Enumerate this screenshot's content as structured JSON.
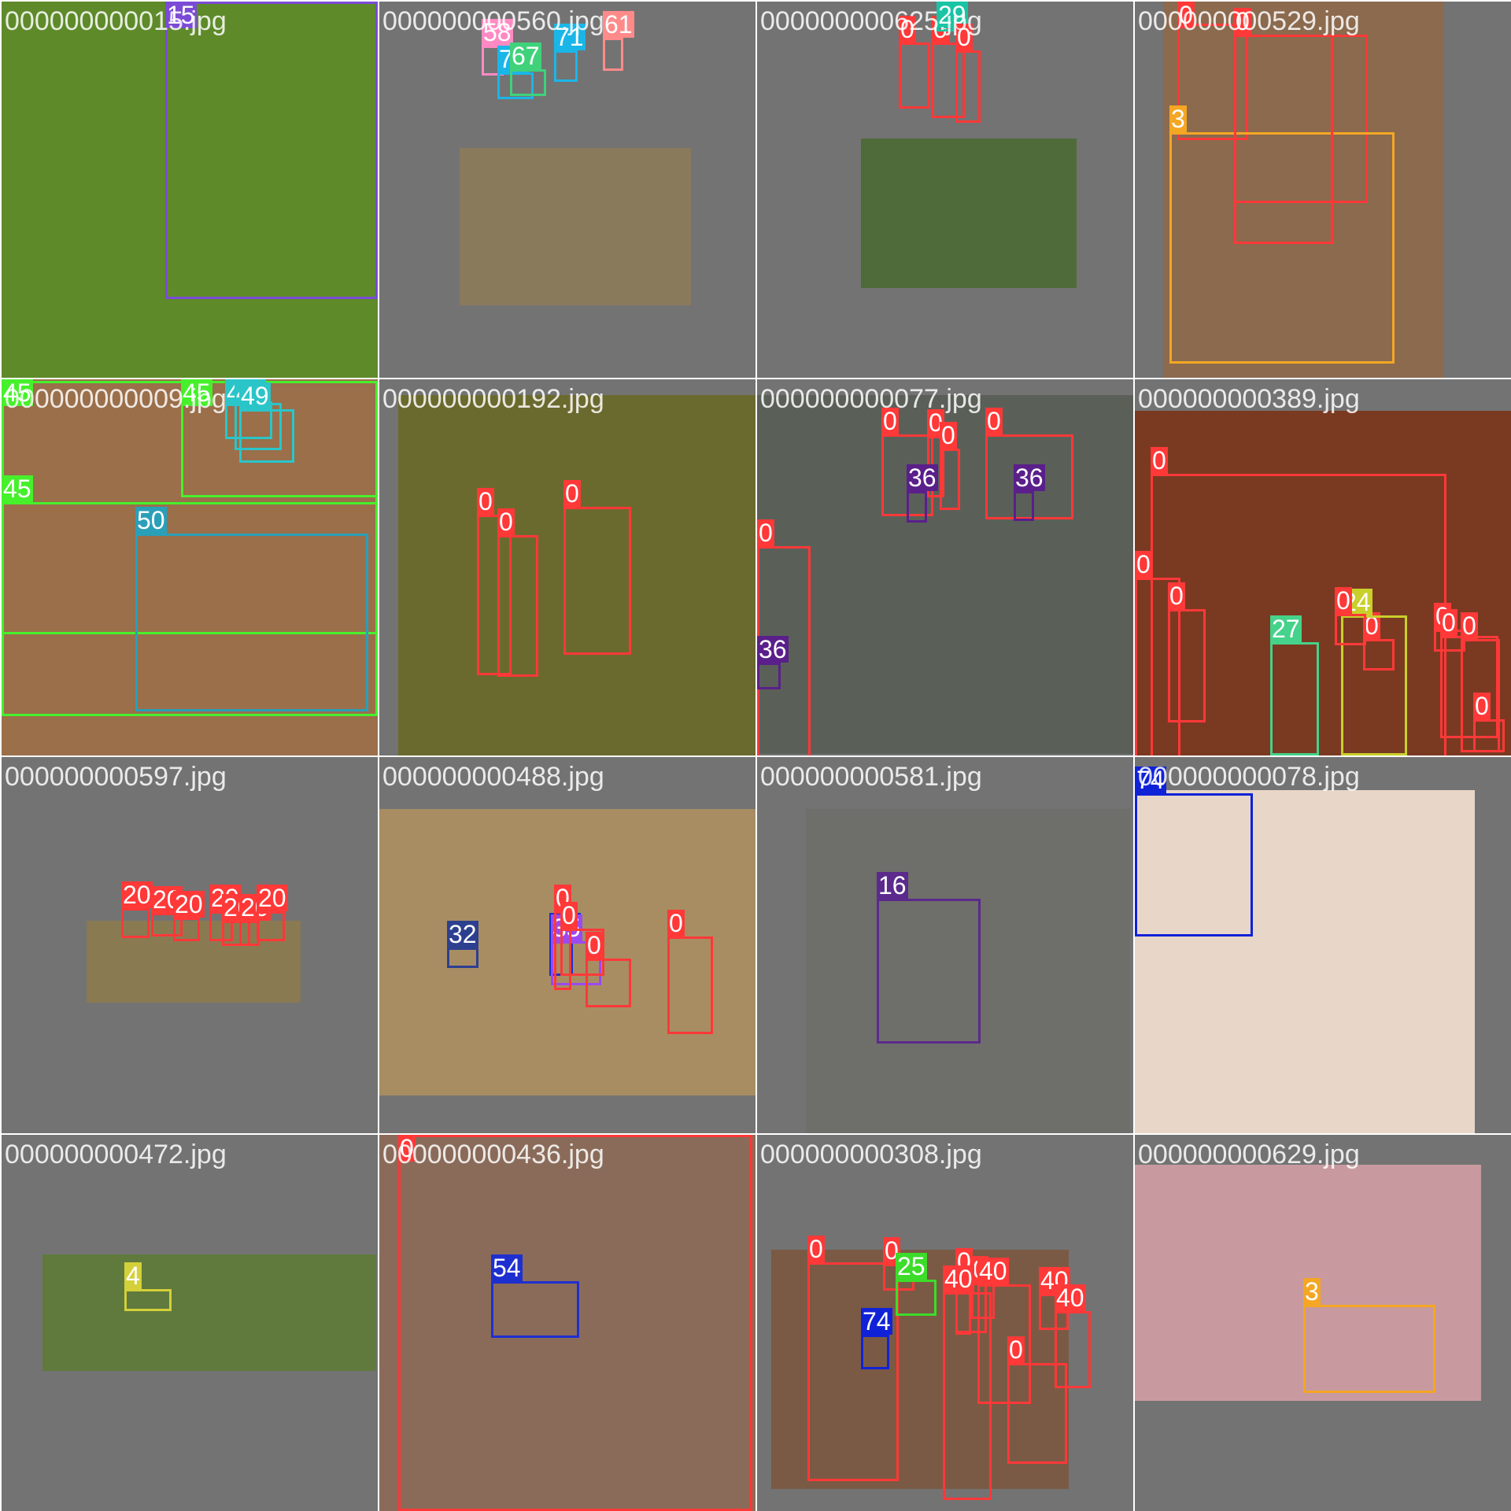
{
  "title": "",
  "colors": {
    "background": "#737373",
    "class_0": "#ff3838",
    "class_3": "#f5a623",
    "class_4": "#d4d03a",
    "class_15": "#7b4bd6",
    "class_16": "#5b2a8c",
    "class_20": "#ff3838",
    "class_24": "#c9cf2b",
    "class_25": "#3ddc2b",
    "class_27": "#45d28a",
    "class_29": "#19c4a4",
    "class_32": "#2d3f8f",
    "class_34": "#1430d2",
    "class_35": "#9b49f2",
    "class_36": "#5a1f8a",
    "class_40": "#ff3838",
    "class_45": "#46f02b",
    "class_49": "#2ac5c9",
    "class_50": "#2a9fb8",
    "class_54": "#1e2fd0",
    "class_58": "#ff8ac3",
    "class_61": "#ff8a8a",
    "class_67": "#3fd27a",
    "class_71": "#1bb6e8",
    "class_74": "#1022d8"
  },
  "tiles": [
    {
      "filename": "000000000015.jpg",
      "photo_color": "#5e8a2a",
      "boxes": [
        {
          "label": "15",
          "color": "#7b4bd6"
        }
      ]
    },
    {
      "filename": "000000000560.jpg",
      "photo_color": "#8a7a5c",
      "boxes": [
        {
          "label": "58",
          "color": "#ff8ac3"
        },
        {
          "label": "71",
          "color": "#1bb6e8"
        },
        {
          "label": "67",
          "color": "#3fd27a"
        },
        {
          "label": "71",
          "color": "#1bb6e8"
        },
        {
          "label": "61",
          "color": "#ff8a8a"
        }
      ]
    },
    {
      "filename": "000000000625.jpg",
      "photo_color": "#4f6b3a",
      "boxes": [
        {
          "label": "0",
          "color": "#ff3838"
        },
        {
          "label": "0",
          "color": "#ff3838"
        },
        {
          "label": "29",
          "color": "#19c4a4"
        },
        {
          "label": "0",
          "color": "#ff3838"
        }
      ]
    },
    {
      "filename": "000000000529.jpg",
      "photo_color": "#8b6a4e",
      "boxes": [
        {
          "label": "0",
          "color": "#ff3838"
        },
        {
          "label": "0",
          "color": "#ff3838"
        },
        {
          "label": "3",
          "color": "#f5a623"
        },
        {
          "label": "0",
          "color": "#ff3838"
        }
      ]
    },
    {
      "filename": "000000000009.jpg",
      "photo_color": "#9a6f4a",
      "boxes": [
        {
          "label": "45",
          "color": "#46f02b"
        },
        {
          "label": "45",
          "color": "#46f02b"
        },
        {
          "label": "49",
          "color": "#2ac5c9"
        },
        {
          "label": "49",
          "color": "#2ac5c9"
        },
        {
          "label": "49",
          "color": "#2ac5c9"
        },
        {
          "label": "45",
          "color": "#46f02b"
        },
        {
          "label": "50",
          "color": "#2a9fb8"
        }
      ]
    },
    {
      "filename": "000000000192.jpg",
      "photo_color": "#6b6a2e",
      "boxes": [
        {
          "label": "0",
          "color": "#ff3838"
        },
        {
          "label": "0",
          "color": "#ff3838"
        },
        {
          "label": "0",
          "color": "#ff3838"
        }
      ]
    },
    {
      "filename": "000000000077.jpg",
      "photo_color": "#5a6058",
      "boxes": [
        {
          "label": "0",
          "color": "#ff3838"
        },
        {
          "label": "0",
          "color": "#ff3838"
        },
        {
          "label": "0",
          "color": "#ff3838"
        },
        {
          "label": "0",
          "color": "#ff3838"
        },
        {
          "label": "36",
          "color": "#5a1f8a"
        },
        {
          "label": "36",
          "color": "#5a1f8a"
        },
        {
          "label": "0",
          "color": "#ff3838"
        },
        {
          "label": "36",
          "color": "#5a1f8a"
        }
      ]
    },
    {
      "filename": "000000000389.jpg",
      "photo_color": "#7a3a22",
      "boxes": [
        {
          "label": "0",
          "color": "#ff3838"
        },
        {
          "label": "0",
          "color": "#ff3838"
        },
        {
          "label": "0",
          "color": "#ff3838"
        },
        {
          "label": "0",
          "color": "#ff3838"
        },
        {
          "label": "27",
          "color": "#45d28a"
        },
        {
          "label": "24",
          "color": "#c9cf2b"
        },
        {
          "label": "0",
          "color": "#ff3838"
        },
        {
          "label": "0",
          "color": "#ff3838"
        },
        {
          "label": "0",
          "color": "#ff3838"
        },
        {
          "label": "0",
          "color": "#ff3838"
        },
        {
          "label": "0",
          "color": "#ff3838"
        }
      ]
    },
    {
      "filename": "000000000597.jpg",
      "photo_color": "#8a7a52",
      "boxes": [
        {
          "label": "20",
          "color": "#ff3838"
        },
        {
          "label": "20",
          "color": "#ff3838"
        },
        {
          "label": "20",
          "color": "#ff3838"
        },
        {
          "label": "20",
          "color": "#ff3838"
        },
        {
          "label": "20",
          "color": "#ff3838"
        },
        {
          "label": "20",
          "color": "#ff3838"
        },
        {
          "label": "20",
          "color": "#ff3838"
        }
      ]
    },
    {
      "filename": "000000000488.jpg",
      "photo_color": "#a88d63",
      "boxes": [
        {
          "label": "32",
          "color": "#2d3f8f"
        },
        {
          "label": "34",
          "color": "#1430d2"
        },
        {
          "label": "35",
          "color": "#9b49f2"
        },
        {
          "label": "0",
          "color": "#ff3838"
        },
        {
          "label": "0",
          "color": "#ff3838"
        },
        {
          "label": "0",
          "color": "#ff3838"
        },
        {
          "label": "0",
          "color": "#ff3838"
        }
      ]
    },
    {
      "filename": "000000000581.jpg",
      "photo_color": "#6e6e6a",
      "boxes": [
        {
          "label": "16",
          "color": "#5b2a8c"
        }
      ]
    },
    {
      "filename": "000000000078.jpg",
      "photo_color": "#e8d6c8",
      "boxes": [
        {
          "label": "74",
          "color": "#1022d8"
        }
      ]
    },
    {
      "filename": "000000000472.jpg",
      "photo_color": "#5f7a3c",
      "boxes": [
        {
          "label": "4",
          "color": "#d4d03a"
        }
      ]
    },
    {
      "filename": "000000000436.jpg",
      "photo_color": "#8a6b5a",
      "boxes": [
        {
          "label": "0",
          "color": "#ff3838"
        },
        {
          "label": "54",
          "color": "#1e2fd0"
        }
      ]
    },
    {
      "filename": "000000000308.jpg",
      "photo_color": "#7a5a44",
      "boxes": [
        {
          "label": "0",
          "color": "#ff3838"
        },
        {
          "label": "0",
          "color": "#ff3838"
        },
        {
          "label": "25",
          "color": "#3ddc2b"
        },
        {
          "label": "0",
          "color": "#ff3838"
        },
        {
          "label": "0",
          "color": "#ff3838"
        },
        {
          "label": "0",
          "color": "#ff3838"
        },
        {
          "label": "40",
          "color": "#ff3838"
        },
        {
          "label": "40",
          "color": "#ff3838"
        },
        {
          "label": "40",
          "color": "#ff3838"
        },
        {
          "label": "74",
          "color": "#1022d8"
        },
        {
          "label": "40",
          "color": "#ff3838"
        },
        {
          "label": "0",
          "color": "#ff3838"
        }
      ]
    },
    {
      "filename": "000000000629.jpg",
      "photo_color": "#c89aa0",
      "boxes": [
        {
          "label": "3",
          "color": "#f5a623"
        }
      ]
    }
  ]
}
